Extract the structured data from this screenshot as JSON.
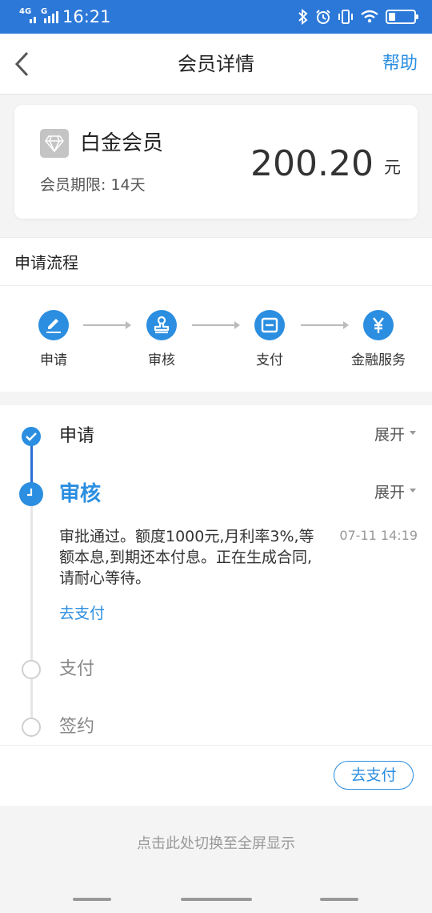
{
  "status_bar": {
    "network": "4G",
    "network2": "G",
    "time": "16:21"
  },
  "nav": {
    "title": "会员详情",
    "help": "帮助"
  },
  "member": {
    "tier": "白金会员",
    "period": "会员期限: 14天",
    "amount": "200.20",
    "unit": "元"
  },
  "process": {
    "title": "申请流程",
    "steps": [
      {
        "label": "申请",
        "icon": "pencil-icon"
      },
      {
        "label": "审核",
        "icon": "stamp-icon"
      },
      {
        "label": "支付",
        "icon": "wallet-icon"
      },
      {
        "label": "金融服务",
        "icon": "yen-icon"
      }
    ]
  },
  "timeline": {
    "expand_label": "展开",
    "items": [
      {
        "label": "申请",
        "state": "done"
      },
      {
        "label": "审核",
        "state": "current"
      },
      {
        "label": "支付",
        "state": "pending"
      },
      {
        "label": "签约",
        "state": "pending"
      }
    ],
    "message": "审批通过。额度1000元,月利率3%,等额本息,到期还本付息。正在生成合同,请耐心等待。",
    "message_time": "07-11 14:19",
    "message_link": "去支付"
  },
  "pay_button": "去支付",
  "fullscreen_hint": "点击此处切换至全屏显示",
  "colors": {
    "status_bar": "#2b78d8",
    "accent": "#2b8ee0",
    "timeline_active": "#2b6fd8"
  }
}
